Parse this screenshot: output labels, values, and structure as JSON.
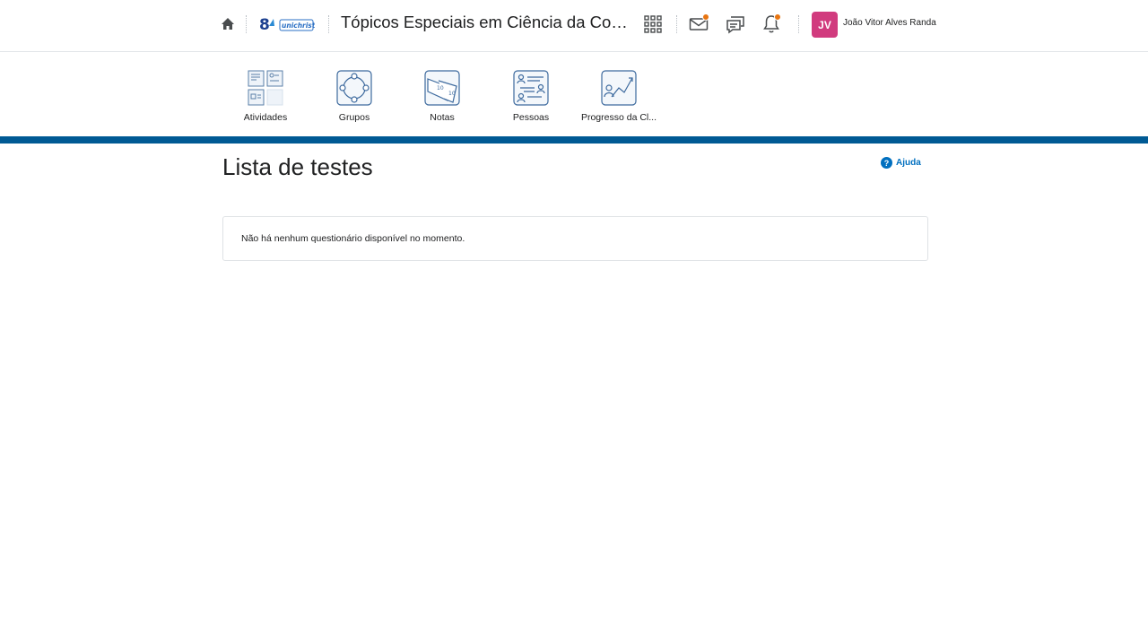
{
  "header": {
    "logo_label": "Unichristus",
    "course_title": "Tópicos Especiais em Ciência da Compu...",
    "user": {
      "initials": "JV",
      "name": "João Vitor Alves Randa",
      "avatar_color": "#d13b7e"
    },
    "icons": [
      "home-icon",
      "waffle-grid-icon",
      "mail-icon",
      "chat-icon",
      "bell-icon"
    ],
    "notification_color": "#e87511"
  },
  "nav": {
    "items": [
      {
        "label": "Atividades",
        "icon": "activities-icon"
      },
      {
        "label": "Grupos",
        "icon": "groups-icon"
      },
      {
        "label": "Notas",
        "icon": "grades-icon"
      },
      {
        "label": "Pessoas",
        "icon": "people-icon"
      },
      {
        "label": "Progresso da Cl...",
        "icon": "class-progress-icon"
      }
    ],
    "band_color": "#005a94"
  },
  "main": {
    "title": "Lista de testes",
    "help_label": "Ajuda",
    "empty_message": "Não há nenhum questionário disponível no momento."
  }
}
